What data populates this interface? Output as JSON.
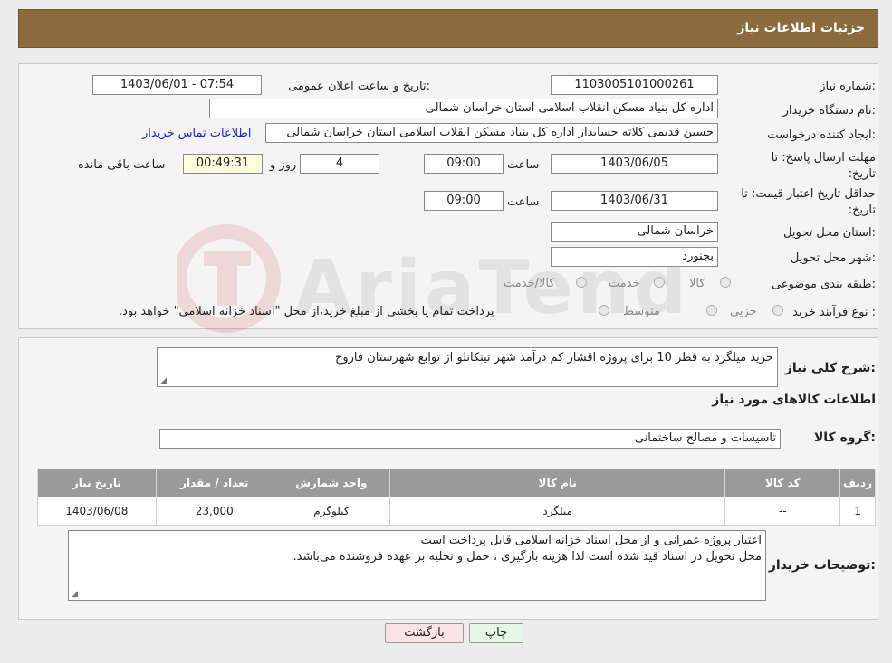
{
  "header": {
    "title": "جزئیات اطلاعات نیاز"
  },
  "fields": {
    "need_number_label": "شماره نیاز:",
    "need_number": "1103005101000261",
    "announce_label": "تاریخ و ساعت اعلان عمومی:",
    "announce_value": "1403/06/01 - 07:54",
    "buyer_org_label": "نام دستگاه خریدار:",
    "buyer_org": "اداره کل بنیاد مسکن انقلاب اسلامی استان خراسان شمالی",
    "creator_label": "ایجاد کننده درخواست:",
    "creator": "حسین قدیمی کلاته حسابدار اداره کل بنیاد مسکن انقلاب اسلامی استان خراسان شمالی",
    "contact_link": "اطلاعات تماس خریدار",
    "deadline_label": "مهلت ارسال پاسخ: تا تاریخ:",
    "deadline_date": "1403/06/05",
    "time_label": "ساعت",
    "deadline_time": "09:00",
    "days_value": "4",
    "days_label": "روز و",
    "remaining_value": "00:49:31",
    "remaining_label": "ساعت باقی مانده",
    "validity_label": "حداقل تاریخ اعتبار قیمت: تا تاریخ:",
    "validity_date": "1403/06/31",
    "validity_time": "09:00",
    "province_label": "استان محل تحویل:",
    "province": "خراسان شمالی",
    "city_label": "شهر محل تحویل:",
    "city": "بجنورد",
    "category_label": "طبقه بندی موضوعی:",
    "category_options": [
      "کالا",
      "خدمت",
      "کالا/خدمت"
    ],
    "process_label": "نوع فرآیند خرید :",
    "process_options": [
      "جزیی",
      "متوسط"
    ],
    "process_note": "پرداخت تمام یا بخشی از مبلغ خرید،از محل \"اسناد خزانه اسلامی\" خواهد بود."
  },
  "details": {
    "summary_label": "شرح کلی نیاز:",
    "summary": "خرید میلگرد به قطر 10 برای پروژه اقشار کم درآمد شهر تیتکانلو از توابع شهرستان فاروج",
    "goods_info_title": "اطلاعات کالاهای مورد نیاز",
    "goods_group_label": "گروه کالا:",
    "goods_group": "تاسیسات و مصالح ساختمانی"
  },
  "table": {
    "headers": [
      "ردیف",
      "کد کالا",
      "نام کالا",
      "واحد شمارش",
      "تعداد / مقدار",
      "تاریخ نیاز"
    ],
    "rows": [
      [
        "1",
        "--",
        "میلگرد",
        "کیلوگرم",
        "23,000",
        "1403/06/08"
      ]
    ]
  },
  "buyer_notes": {
    "label": "توضیحات خریدار:",
    "line1": "اعتبار پروژه عمرانی و از محل اسناد خزانه اسلامی قابل پرداخت است",
    "line2": "محل تحویل در اسناد قید شده است لذا هزینه بارگیری ، حمل و تخلیه بر عهده فروشنده می‌باشد."
  },
  "buttons": {
    "print": "چاپ",
    "back": "بازگشت"
  },
  "colors": {
    "header": "#8b6a3e",
    "link": "#2222cc",
    "table_header": "#9a9a9a"
  }
}
